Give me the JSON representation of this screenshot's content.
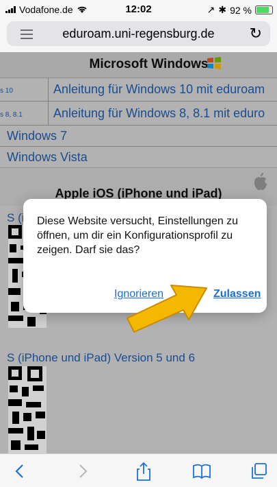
{
  "status_bar": {
    "carrier": "Vodafone.de",
    "time": "12:02",
    "battery_percent_label": "92 %",
    "battery_level": 0.92
  },
  "browser": {
    "url": "eduroam.uni-regensburg.de"
  },
  "page": {
    "ms_section_title": "Microsoft Windows",
    "rows": [
      {
        "version": "s 10",
        "link": "Anleitung für Windows 10 mit eduroam"
      },
      {
        "version": "s 8, 8.1",
        "link": "Anleitung für Windows 8, 8.1 mit eduro"
      }
    ],
    "links": [
      "Windows 7",
      "Windows Vista"
    ],
    "apple_section_title": "Apple iOS (iPhone und iPad)",
    "partial_link_top": "S (i",
    "ios_link": "S (iPhone und iPad) Version 5 und 6"
  },
  "dialog": {
    "message": "Diese Website versucht, Einstellungen zu öffnen, um dir ein Konfigurationsprofil zu zeigen. Darf sie das?",
    "ignore_label": "Ignorieren",
    "allow_label": "Zulassen"
  },
  "colors": {
    "link": "#1f5fb0",
    "dialog_button": "#1a6fd8",
    "arrow": "#f5b800"
  }
}
